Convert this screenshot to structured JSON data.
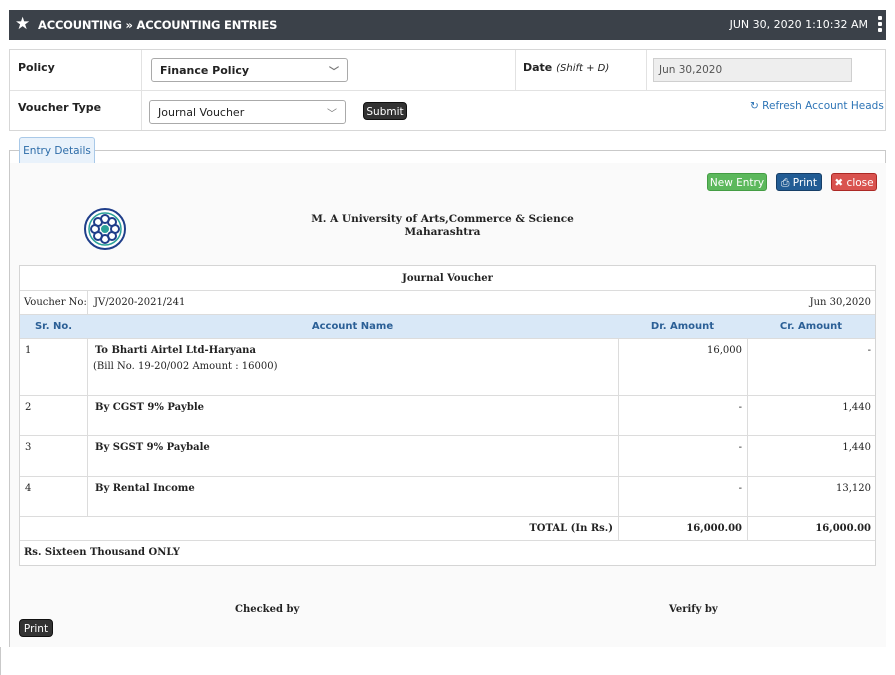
{
  "header": {
    "breadcrumb": "ACCOUNTING » ACCOUNTING ENTRIES",
    "datetime": "JUN 30, 2020  1:10:32 AM"
  },
  "form": {
    "policy_label": "Policy",
    "policy_value": "Finance Policy",
    "date_label": "Date",
    "date_hint": "(Shift + D)",
    "date_value": "Jun 30,2020",
    "voucher_type_label": "Voucher Type",
    "voucher_type_value": "Journal Voucher",
    "submit_label": "Submit",
    "refresh_label": "Refresh Account Heads"
  },
  "tab": {
    "label": "Entry Details"
  },
  "actions": {
    "new_entry": "New Entry",
    "print": "Print",
    "close": "close"
  },
  "institution": {
    "name": "M. A University of Arts,Commerce & Science",
    "location": "Maharashtra"
  },
  "voucher": {
    "title": "Journal Voucher",
    "no_label": "Voucher No:",
    "no_value": "JV/2020-2021/241",
    "date": "Jun 30,2020",
    "columns": {
      "sr": "Sr. No.",
      "account": "Account Name",
      "dr": "Dr. Amount",
      "cr": "Cr. Amount"
    },
    "rows": [
      {
        "sr": "1",
        "account": "To Bharti Airtel Ltd-Haryana",
        "note": "(Bill No. 19-20/002 Amount : 16000)",
        "dr": "16,000",
        "cr": "-"
      },
      {
        "sr": "2",
        "account": "By CGST 9% Payble",
        "note": "",
        "dr": "-",
        "cr": "1,440"
      },
      {
        "sr": "3",
        "account": "By SGST 9% Paybale",
        "note": "",
        "dr": "-",
        "cr": "1,440"
      },
      {
        "sr": "4",
        "account": "By Rental Income",
        "note": "",
        "dr": "-",
        "cr": "13,120"
      }
    ],
    "total_label": "TOTAL (In Rs.)",
    "total_dr": "16,000.00",
    "total_cr": "16,000.00",
    "amount_words": "Rs. Sixteen Thousand ONLY"
  },
  "signatures": {
    "checked": "Checked by",
    "verify": "Verify by"
  },
  "footer": {
    "print": "Print"
  }
}
